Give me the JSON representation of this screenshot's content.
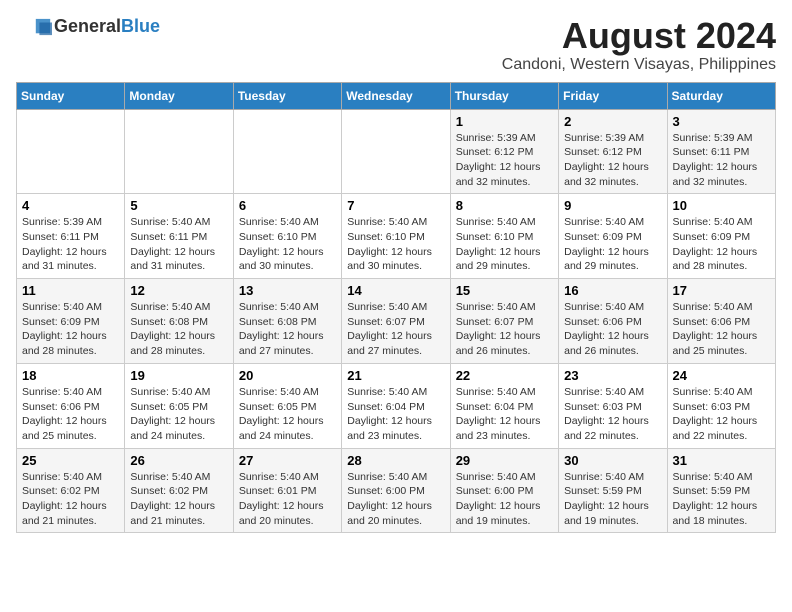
{
  "header": {
    "logo_general": "General",
    "logo_blue": "Blue",
    "title": "August 2024",
    "subtitle": "Candoni, Western Visayas, Philippines"
  },
  "days_of_week": [
    "Sunday",
    "Monday",
    "Tuesday",
    "Wednesday",
    "Thursday",
    "Friday",
    "Saturday"
  ],
  "weeks": [
    [
      {
        "day": "",
        "sunrise": "",
        "sunset": "",
        "daylight": ""
      },
      {
        "day": "",
        "sunrise": "",
        "sunset": "",
        "daylight": ""
      },
      {
        "day": "",
        "sunrise": "",
        "sunset": "",
        "daylight": ""
      },
      {
        "day": "",
        "sunrise": "",
        "sunset": "",
        "daylight": ""
      },
      {
        "day": "1",
        "sunrise": "Sunrise: 5:39 AM",
        "sunset": "Sunset: 6:12 PM",
        "daylight": "Daylight: 12 hours and 32 minutes."
      },
      {
        "day": "2",
        "sunrise": "Sunrise: 5:39 AM",
        "sunset": "Sunset: 6:12 PM",
        "daylight": "Daylight: 12 hours and 32 minutes."
      },
      {
        "day": "3",
        "sunrise": "Sunrise: 5:39 AM",
        "sunset": "Sunset: 6:11 PM",
        "daylight": "Daylight: 12 hours and 32 minutes."
      }
    ],
    [
      {
        "day": "4",
        "sunrise": "Sunrise: 5:39 AM",
        "sunset": "Sunset: 6:11 PM",
        "daylight": "Daylight: 12 hours and 31 minutes."
      },
      {
        "day": "5",
        "sunrise": "Sunrise: 5:40 AM",
        "sunset": "Sunset: 6:11 PM",
        "daylight": "Daylight: 12 hours and 31 minutes."
      },
      {
        "day": "6",
        "sunrise": "Sunrise: 5:40 AM",
        "sunset": "Sunset: 6:10 PM",
        "daylight": "Daylight: 12 hours and 30 minutes."
      },
      {
        "day": "7",
        "sunrise": "Sunrise: 5:40 AM",
        "sunset": "Sunset: 6:10 PM",
        "daylight": "Daylight: 12 hours and 30 minutes."
      },
      {
        "day": "8",
        "sunrise": "Sunrise: 5:40 AM",
        "sunset": "Sunset: 6:10 PM",
        "daylight": "Daylight: 12 hours and 29 minutes."
      },
      {
        "day": "9",
        "sunrise": "Sunrise: 5:40 AM",
        "sunset": "Sunset: 6:09 PM",
        "daylight": "Daylight: 12 hours and 29 minutes."
      },
      {
        "day": "10",
        "sunrise": "Sunrise: 5:40 AM",
        "sunset": "Sunset: 6:09 PM",
        "daylight": "Daylight: 12 hours and 28 minutes."
      }
    ],
    [
      {
        "day": "11",
        "sunrise": "Sunrise: 5:40 AM",
        "sunset": "Sunset: 6:09 PM",
        "daylight": "Daylight: 12 hours and 28 minutes."
      },
      {
        "day": "12",
        "sunrise": "Sunrise: 5:40 AM",
        "sunset": "Sunset: 6:08 PM",
        "daylight": "Daylight: 12 hours and 28 minutes."
      },
      {
        "day": "13",
        "sunrise": "Sunrise: 5:40 AM",
        "sunset": "Sunset: 6:08 PM",
        "daylight": "Daylight: 12 hours and 27 minutes."
      },
      {
        "day": "14",
        "sunrise": "Sunrise: 5:40 AM",
        "sunset": "Sunset: 6:07 PM",
        "daylight": "Daylight: 12 hours and 27 minutes."
      },
      {
        "day": "15",
        "sunrise": "Sunrise: 5:40 AM",
        "sunset": "Sunset: 6:07 PM",
        "daylight": "Daylight: 12 hours and 26 minutes."
      },
      {
        "day": "16",
        "sunrise": "Sunrise: 5:40 AM",
        "sunset": "Sunset: 6:06 PM",
        "daylight": "Daylight: 12 hours and 26 minutes."
      },
      {
        "day": "17",
        "sunrise": "Sunrise: 5:40 AM",
        "sunset": "Sunset: 6:06 PM",
        "daylight": "Daylight: 12 hours and 25 minutes."
      }
    ],
    [
      {
        "day": "18",
        "sunrise": "Sunrise: 5:40 AM",
        "sunset": "Sunset: 6:06 PM",
        "daylight": "Daylight: 12 hours and 25 minutes."
      },
      {
        "day": "19",
        "sunrise": "Sunrise: 5:40 AM",
        "sunset": "Sunset: 6:05 PM",
        "daylight": "Daylight: 12 hours and 24 minutes."
      },
      {
        "day": "20",
        "sunrise": "Sunrise: 5:40 AM",
        "sunset": "Sunset: 6:05 PM",
        "daylight": "Daylight: 12 hours and 24 minutes."
      },
      {
        "day": "21",
        "sunrise": "Sunrise: 5:40 AM",
        "sunset": "Sunset: 6:04 PM",
        "daylight": "Daylight: 12 hours and 23 minutes."
      },
      {
        "day": "22",
        "sunrise": "Sunrise: 5:40 AM",
        "sunset": "Sunset: 6:04 PM",
        "daylight": "Daylight: 12 hours and 23 minutes."
      },
      {
        "day": "23",
        "sunrise": "Sunrise: 5:40 AM",
        "sunset": "Sunset: 6:03 PM",
        "daylight": "Daylight: 12 hours and 22 minutes."
      },
      {
        "day": "24",
        "sunrise": "Sunrise: 5:40 AM",
        "sunset": "Sunset: 6:03 PM",
        "daylight": "Daylight: 12 hours and 22 minutes."
      }
    ],
    [
      {
        "day": "25",
        "sunrise": "Sunrise: 5:40 AM",
        "sunset": "Sunset: 6:02 PM",
        "daylight": "Daylight: 12 hours and 21 minutes."
      },
      {
        "day": "26",
        "sunrise": "Sunrise: 5:40 AM",
        "sunset": "Sunset: 6:02 PM",
        "daylight": "Daylight: 12 hours and 21 minutes."
      },
      {
        "day": "27",
        "sunrise": "Sunrise: 5:40 AM",
        "sunset": "Sunset: 6:01 PM",
        "daylight": "Daylight: 12 hours and 20 minutes."
      },
      {
        "day": "28",
        "sunrise": "Sunrise: 5:40 AM",
        "sunset": "Sunset: 6:00 PM",
        "daylight": "Daylight: 12 hours and 20 minutes."
      },
      {
        "day": "29",
        "sunrise": "Sunrise: 5:40 AM",
        "sunset": "Sunset: 6:00 PM",
        "daylight": "Daylight: 12 hours and 19 minutes."
      },
      {
        "day": "30",
        "sunrise": "Sunrise: 5:40 AM",
        "sunset": "Sunset: 5:59 PM",
        "daylight": "Daylight: 12 hours and 19 minutes."
      },
      {
        "day": "31",
        "sunrise": "Sunrise: 5:40 AM",
        "sunset": "Sunset: 5:59 PM",
        "daylight": "Daylight: 12 hours and 18 minutes."
      }
    ]
  ]
}
